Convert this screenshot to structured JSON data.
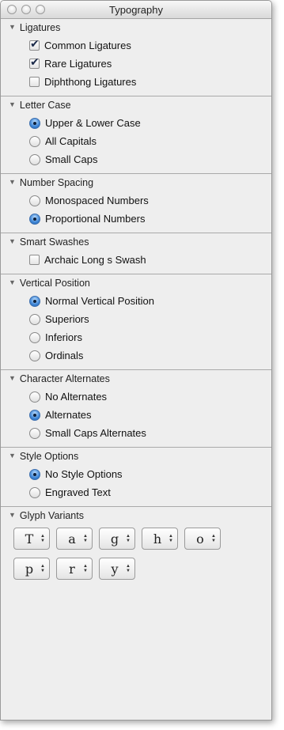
{
  "window": {
    "title": "Typography"
  },
  "sections": {
    "ligatures": {
      "title": "Ligatures",
      "items": [
        {
          "label": "Common Ligatures",
          "checked": true
        },
        {
          "label": "Rare Ligatures",
          "checked": true
        },
        {
          "label": "Diphthong Ligatures",
          "checked": false
        }
      ]
    },
    "letter_case": {
      "title": "Letter Case",
      "items": [
        {
          "label": "Upper & Lower Case",
          "selected": true
        },
        {
          "label": "All Capitals",
          "selected": false
        },
        {
          "label": "Small Caps",
          "selected": false
        }
      ]
    },
    "number_spacing": {
      "title": "Number Spacing",
      "items": [
        {
          "label": "Monospaced Numbers",
          "selected": false
        },
        {
          "label": "Proportional Numbers",
          "selected": true
        }
      ]
    },
    "smart_swashes": {
      "title": "Smart Swashes",
      "items": [
        {
          "label": "Archaic Long s Swash",
          "checked": false
        }
      ]
    },
    "vertical_position": {
      "title": "Vertical Position",
      "items": [
        {
          "label": "Normal Vertical Position",
          "selected": true
        },
        {
          "label": "Superiors",
          "selected": false
        },
        {
          "label": "Inferiors",
          "selected": false
        },
        {
          "label": "Ordinals",
          "selected": false
        }
      ]
    },
    "character_alternates": {
      "title": "Character Alternates",
      "items": [
        {
          "label": "No Alternates",
          "selected": false
        },
        {
          "label": "Alternates",
          "selected": true
        },
        {
          "label": "Small Caps Alternates",
          "selected": false
        }
      ]
    },
    "style_options": {
      "title": "Style Options",
      "items": [
        {
          "label": "No Style Options",
          "selected": true
        },
        {
          "label": "Engraved Text",
          "selected": false
        }
      ]
    },
    "glyph_variants": {
      "title": "Glyph Variants",
      "glyphs": [
        "T",
        "a",
        "g",
        "h",
        "o",
        "p",
        "r",
        "y"
      ]
    }
  },
  "icons": {
    "disclosure": "disclosure-triangle-icon",
    "stepper": "stepper-arrows-icon"
  },
  "colors": {
    "accent": "#3f86d6",
    "panel": "#eeeeee"
  }
}
